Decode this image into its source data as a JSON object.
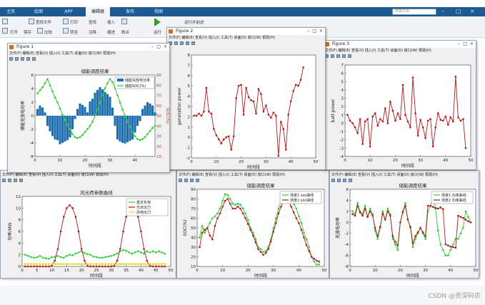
{
  "desktop": {
    "tabs": [
      "主页",
      "绘图",
      "APP",
      "编辑器",
      "发布",
      "视图"
    ],
    "active_tab": "编辑器",
    "search_placeholder": "搜索文档",
    "ribbon_items": [
      "查找文件",
      "打开",
      "保存",
      "比较",
      "打印",
      "转至",
      "查找",
      "注释",
      "缩进",
      "插入",
      "运行",
      "断点",
      "运行",
      "fx",
      "运行并前进"
    ],
    "watermark": "CSDN @资深码农"
  },
  "figures": {
    "fig1": {
      "title": "Figure 1",
      "menu": "文件(F) 编辑(E) 查看(V) 插入(I) 工具(T) 桌面(D) 窗口(W) 帮助(H)"
    },
    "fig2": {
      "title": "Figure 2",
      "menu": "文件(F) 编辑(E) 查看(V) 插入(I) 工具(T) 桌面(D) 窗口(W) 帮助(H)"
    },
    "fig3": {
      "title": "Figure 3",
      "menu": "文件(F) 编辑(E) 查看(V) 插入(I) 工具(T) 桌面(D) 窗口(W) 帮助(H)"
    },
    "fig4": {
      "title": "",
      "menu": "文件(F) 编辑(E) 查看(V) 插入(I) 工具(T) 桌面(D) 窗口(W) 帮助(H)"
    },
    "fig5": {
      "title": "",
      "menu": "文件(F) 编辑(E) 查看(V) 插入(I) 工具(T) 桌面(D) 窗口(W) 帮助(H)"
    },
    "fig6": {
      "title": "",
      "menu": "文件(F) 编辑(E) 查看(V) 插入(I) 工具(T) 桌面(D) 窗口(W) 帮助(H)"
    }
  },
  "chart_data": [
    {
      "id": "fig1",
      "type": "bar",
      "title": "储能调度结果",
      "xlabel": "时间段",
      "ylabel": "储能充放电功率",
      "y2label": "SOC(%)",
      "xlim": [
        0,
        48
      ],
      "ylim": [
        -6,
        6
      ],
      "y2lim": [
        10,
        90
      ],
      "xticks": [
        0,
        10,
        20,
        30,
        40
      ],
      "yticks": [
        -6,
        -4,
        -2,
        0,
        2,
        4,
        6
      ],
      "y2ticks": [
        10,
        20,
        30,
        40,
        50,
        60,
        70,
        80,
        90
      ],
      "legend": [
        "储能充放电功率",
        "储能SOC(%)"
      ],
      "bars": [
        1,
        1.5,
        1.2,
        0.5,
        -1.5,
        -2.3,
        -3,
        -3.5,
        -3.6,
        -4.2,
        -4,
        -3.8,
        -3.6,
        -3.2,
        -2,
        -0.5,
        1,
        1.8,
        1.6,
        1.3,
        0.5,
        2.1,
        2.5,
        3.4,
        3.8,
        4.2,
        3.9,
        3.5,
        3.2,
        2.8,
        1.2,
        -1.5,
        -3.5,
        -3.8,
        -4,
        -4.1,
        -3.9,
        -3.7,
        -3.5,
        -2.5,
        -1.5,
        -0.8,
        1,
        1.5,
        2,
        1.8,
        1.5,
        0.5
      ],
      "soc": [
        72,
        75,
        78,
        82,
        86,
        80,
        74,
        68,
        63,
        57,
        51,
        46,
        41,
        37,
        32,
        29,
        28,
        29,
        31,
        34,
        37,
        40,
        44,
        50,
        56,
        63,
        70,
        77,
        82,
        86,
        83,
        77,
        70,
        63,
        56,
        50,
        44,
        39,
        34,
        30,
        27,
        26,
        27,
        29,
        32,
        35,
        38,
        40
      ]
    },
    {
      "id": "fig2",
      "type": "line",
      "xlabel": "时间段",
      "ylabel": "generation power",
      "xlim": [
        0,
        50
      ],
      "ylim": [
        -2,
        8
      ],
      "xticks": [
        0,
        10,
        20,
        30,
        40,
        50
      ],
      "yticks": [
        -2,
        -1,
        0,
        1,
        2,
        3,
        4,
        5,
        6,
        7,
        8
      ],
      "values": [
        2.1,
        2.1,
        2.3,
        2.1,
        2.5,
        4.8,
        2.5,
        2.3,
        0.8,
        0.2,
        -0.2,
        -0.6,
        -0.2,
        0,
        0.1,
        -1.2,
        0.1,
        3.8,
        5,
        5.1,
        2.2,
        4.8,
        3.9,
        3.6,
        3.5,
        2.3,
        4.7,
        4.2,
        2.5,
        3.1,
        2.2,
        1.9,
        2.4,
        2.1,
        -1.8,
        1.5,
        0.8,
        -1.2,
        2.2,
        3.5,
        4.5,
        5.1,
        5,
        5.6,
        6.8
      ],
      "x": [
        1,
        2,
        3,
        4,
        5,
        6,
        7,
        8,
        9,
        10,
        11,
        12,
        13,
        14,
        15,
        16,
        17,
        18,
        19,
        20,
        21,
        22,
        23,
        24,
        25,
        26,
        27,
        28,
        29,
        30,
        31,
        32,
        33,
        34,
        35,
        36,
        37,
        38,
        39,
        40,
        41,
        42,
        43,
        44,
        45
      ]
    },
    {
      "id": "fig3",
      "type": "line",
      "xlabel": "时间段",
      "ylabel": "batt power",
      "xlim": [
        0,
        50
      ],
      "ylim": [
        -4,
        7
      ],
      "xticks": [
        0,
        10,
        20,
        30,
        40,
        50
      ],
      "yticks": [
        -4,
        -3,
        -2,
        -1,
        0,
        1,
        2,
        3,
        4,
        5,
        6,
        7
      ],
      "values": [
        1,
        0.3,
        0,
        -0.5,
        -1.2,
        0.5,
        -2.5,
        0.2,
        0.5,
        -2.8,
        0.8,
        1.2,
        -0.3,
        0.5,
        0.2,
        1.8,
        0,
        2.6,
        1.5,
        0.3,
        1.2,
        0.5,
        4.6,
        1,
        0.2,
        -0.5,
        5.5,
        1.2,
        -1.5,
        0.4,
        -0.5,
        -1.8,
        0.3,
        0.5,
        -2.8,
        -0.5,
        1.2,
        0.4,
        0.3,
        0.8,
        -0.2,
        0.7,
        0.2,
        5.6,
        0.7,
        0.3,
        0.5,
        -3
      ],
      "x": [
        1,
        2,
        3,
        4,
        5,
        6,
        7,
        8,
        9,
        10,
        11,
        12,
        13,
        14,
        15,
        16,
        17,
        18,
        19,
        20,
        21,
        22,
        23,
        24,
        25,
        26,
        27,
        28,
        29,
        30,
        31,
        32,
        33,
        34,
        35,
        36,
        37,
        38,
        39,
        40,
        41,
        42,
        43,
        44,
        45,
        46,
        47,
        48
      ]
    },
    {
      "id": "fig4",
      "type": "line",
      "title": "风光荷参数曲线",
      "xlabel": "时间段",
      "ylabel": "功率/MW",
      "xlim": [
        0,
        50
      ],
      "ylim": [
        0,
        12
      ],
      "xticks": [
        0,
        5,
        10,
        15,
        20,
        25,
        30,
        35,
        40,
        45,
        50
      ],
      "yticks": [
        0,
        2,
        4,
        6,
        8,
        10,
        12
      ],
      "legend": [
        "基本负荷",
        "光伏出力",
        "风电出力"
      ],
      "series": [
        {
          "name": "基本负荷",
          "color": "#2ecc2e",
          "values": [
            2,
            1.8,
            1.6,
            1.5,
            1.6,
            1.8,
            1.5,
            1.4,
            1.3,
            1.6,
            1.6,
            1.8,
            1.6,
            1.5,
            1.8,
            2,
            1.9,
            2.2,
            2.4,
            2.6,
            2.3,
            2.1,
            2,
            1.7,
            1.6,
            1.5,
            1.5,
            1.6,
            1.7,
            1.8,
            2,
            2.2,
            2.6,
            2.8,
            2.7,
            2.4,
            2.2,
            2.4,
            2.6,
            2.4,
            2.2,
            2.6,
            2.4,
            2.6,
            2.4,
            2.6,
            2.4,
            2.2
          ]
        },
        {
          "name": "光伏出力",
          "color": "#b01818",
          "values": [
            0,
            0,
            0,
            0,
            0,
            0,
            0,
            0,
            0,
            0.1,
            1,
            3,
            6,
            8.5,
            10,
            10.5,
            10,
            8.5,
            6,
            3,
            1,
            0.1,
            0,
            0,
            0,
            0,
            0,
            0,
            0,
            0,
            0.1,
            1,
            3,
            6,
            8.5,
            10,
            10.5,
            10,
            8.5,
            6,
            3,
            1,
            0.1,
            0,
            0,
            0,
            0,
            0
          ]
        },
        {
          "name": "风电出力",
          "color": "#e8d610",
          "values": [
            0.4,
            0.4,
            0.4,
            0.4,
            0.4,
            0.4,
            0.4,
            0.4,
            0.4,
            0.4,
            0.4,
            0.4,
            0.4,
            0.4,
            0.4,
            0.4,
            0.4,
            0.4,
            0.4,
            0.4,
            0.4,
            0.4,
            0.4,
            0.4,
            0.4,
            0.4,
            0.4,
            0.4,
            0.4,
            0.4,
            0.4,
            0.4,
            0.4,
            0.4,
            0.4,
            0.4,
            0.4,
            0.4,
            0.4,
            0.4,
            0.4,
            0.4,
            0.4,
            0.4,
            0.4,
            0.4,
            0.4,
            0.4
          ]
        }
      ]
    },
    {
      "id": "fig5",
      "type": "line",
      "title": "储能调度结果",
      "xlabel": "时间段",
      "ylabel": "SOC(%)",
      "xlim": [
        0,
        50
      ],
      "ylim": [
        10,
        90
      ],
      "xticks": [
        0,
        10,
        20,
        30,
        40,
        50
      ],
      "yticks": [
        10,
        20,
        30,
        40,
        50,
        60,
        70,
        80,
        90
      ],
      "legend": [
        "场景1 soc曲线",
        "场景2 soc曲线"
      ],
      "series": [
        {
          "name": "场景1 soc曲线",
          "color": "#2ecc2e",
          "values": [
            40,
            52,
            45,
            50,
            55,
            60,
            62,
            65,
            70,
            78,
            85,
            84,
            80,
            75,
            74,
            75,
            74,
            70,
            65,
            58,
            50,
            45,
            38,
            30,
            28,
            25,
            26,
            30,
            38,
            50,
            60,
            70,
            78,
            85,
            86,
            85,
            80,
            75,
            70,
            62,
            55,
            45,
            38,
            30,
            20,
            15,
            12,
            12
          ]
        },
        {
          "name": "场景2 soc曲线",
          "color": "#b01818",
          "values": [
            30,
            45,
            48,
            50,
            42,
            38,
            52,
            60,
            65,
            72,
            78,
            80,
            75,
            70,
            70,
            72,
            70,
            65,
            60,
            54,
            48,
            42,
            35,
            28,
            25,
            22,
            24,
            28,
            36,
            46,
            55,
            65,
            72,
            78,
            80,
            78,
            72,
            66,
            60,
            55,
            48,
            40,
            32,
            26,
            20,
            18,
            16,
            15
          ]
        }
      ]
    },
    {
      "id": "fig6",
      "type": "line",
      "title": "储能调度结果",
      "xlabel": "时间段",
      "ylabel": "充放电功率",
      "xlim": [
        0,
        50
      ],
      "ylim": [
        -8,
        6
      ],
      "xticks": [
        0,
        10,
        20,
        30,
        40,
        50
      ],
      "yticks": [
        -8,
        -6,
        -4,
        -2,
        0,
        2,
        4,
        6
      ],
      "legend": [
        "场景1 功率曲线",
        "场景2 功率曲线"
      ],
      "series": [
        {
          "name": "场景1 功率曲线",
          "color": "#2ecc2e",
          "values": [
            2,
            1.5,
            3.5,
            2,
            1.5,
            3,
            1,
            2.5,
            1.5,
            -1.5,
            -3,
            -1,
            2,
            0.5,
            2.5,
            1.5,
            -3,
            -4,
            -5,
            0,
            2,
            3.5,
            0.5,
            -1,
            -4.5,
            -3,
            -2,
            -1,
            -2,
            -3,
            2,
            3,
            4.5,
            2.5,
            -1.5,
            -4,
            -5,
            -6,
            -6,
            -5,
            -4,
            -3,
            -3,
            -2,
            -1,
            2,
            1,
            0
          ]
        },
        {
          "name": "场景2 功率曲线",
          "color": "#b01818",
          "values": [
            1.5,
            1.2,
            3,
            1.8,
            1.2,
            2.5,
            1,
            2,
            1.2,
            -1,
            -2.5,
            -0.8,
            1.6,
            0.5,
            2,
            1.2,
            -2.5,
            -3.5,
            -4.2,
            0,
            1.8,
            3,
            0.5,
            -0.8,
            -3.8,
            -2.5,
            -1.8,
            -1,
            -1.8,
            -2.5,
            3,
            3,
            2.8,
            2.6,
            2.5,
            2.7,
            2.4,
            -4,
            -4.2,
            -4.4,
            -4.5,
            -4.6,
            1.2,
            1,
            0.8,
            0.5,
            0.2,
            0
          ]
        }
      ]
    }
  ]
}
